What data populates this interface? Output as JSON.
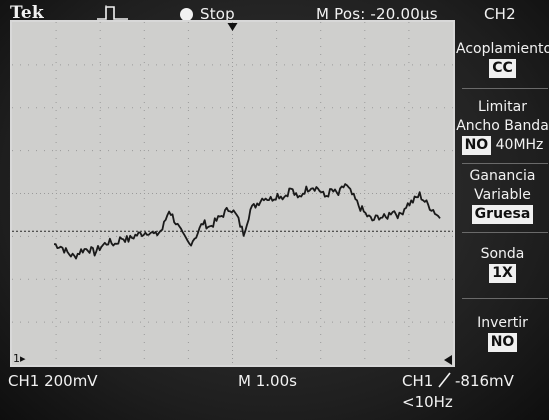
{
  "top_bar": {
    "brand": "Tek",
    "trigger_icon": "trigger-pulse-icon",
    "run_state": "Stop",
    "position": "M Pos: -20.00µs",
    "channel": "CH2"
  },
  "menu": {
    "items": [
      {
        "title": "Acoplamiento",
        "value": "CC"
      },
      {
        "title": "Limitar\nAncho Banda",
        "value_hi": "NO",
        "value_lo": "40MHz"
      },
      {
        "title": "Ganancia\nVariable",
        "value": "Gruesa"
      },
      {
        "title": "Sonda",
        "value": "1X"
      },
      {
        "title": "Invertir",
        "value": "NO"
      }
    ]
  },
  "bottom_bar": {
    "ch1_scale": "CH1  200mV",
    "time_scale": "M 1.00s",
    "trigger_source": "CH1",
    "trigger_slope_icon": "rising-edge-icon",
    "trigger_level": "-816mV",
    "trigger_freq": "<10Hz"
  },
  "markers": {
    "ground_marker": "1",
    "trigger_position_icon": "trigger-position-arrow-icon",
    "trigger_level_icon": "trigger-level-arrow-icon"
  },
  "chart_data": {
    "type": "line",
    "x_divisions": 10,
    "y_divisions": 8,
    "series": [
      {
        "values": [
          2.75,
          2.7,
          2.55,
          2.45,
          2.6,
          2.65,
          2.55,
          2.7,
          2.8,
          2.75,
          2.9,
          2.85,
          2.95,
          3.0,
          3.05,
          2.95,
          3.1,
          3.55,
          3.25,
          2.95,
          2.75,
          2.95,
          3.25,
          3.15,
          3.3,
          3.45,
          3.6,
          3.4,
          3.0,
          3.55,
          3.7,
          3.85,
          3.8,
          3.9,
          3.85,
          4.05,
          3.8,
          4.0,
          4.1,
          4.05,
          3.85,
          4.0,
          3.9,
          4.15,
          3.9,
          3.65,
          3.45,
          3.3,
          3.4,
          3.35,
          3.55,
          3.4,
          3.65,
          3.75,
          3.9,
          3.7,
          3.55,
          3.35
        ]
      }
    ],
    "trace_color": "#1a1a1a",
    "trigger_level_div": 3.05,
    "ground_level_div": 0.0
  }
}
